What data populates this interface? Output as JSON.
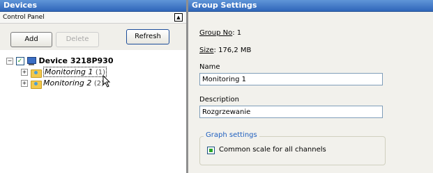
{
  "devices_panel": {
    "title": "Devices",
    "control_panel_label": "Control Panel",
    "collapse_glyph": "▲",
    "buttons": {
      "add": "Add",
      "delete": "Delete",
      "refresh": "Refresh"
    },
    "tree": {
      "device": {
        "expander": "⊟",
        "checked": "✓",
        "name": "Device 3218P930",
        "icon": "monitor-icon"
      },
      "items": [
        {
          "expander": "+",
          "name": "Monitoring 1",
          "count": "(1)",
          "icon": "group-folder-icon"
        },
        {
          "expander": "+",
          "name": "Monitoring 2",
          "count": "(2)",
          "icon": "group-folder-icon"
        }
      ]
    }
  },
  "group_settings": {
    "title": "Group Settings",
    "group_no_label": "Group No",
    "group_no_value": ": 1",
    "size_label": "Size",
    "size_value": ": 176,2 MB",
    "name_label": "Name",
    "name_value": "Monitoring 1",
    "description_label": "Description",
    "description_value": "Rozgrzewanie",
    "graph_settings_title": "Graph settings",
    "common_scale_label": "Common scale for all channels",
    "common_scale_checked": true
  },
  "colors": {
    "header_blue": "#2f66b9",
    "panel_bg": "#f2f1ec",
    "group_title": "#1f5fbf"
  }
}
